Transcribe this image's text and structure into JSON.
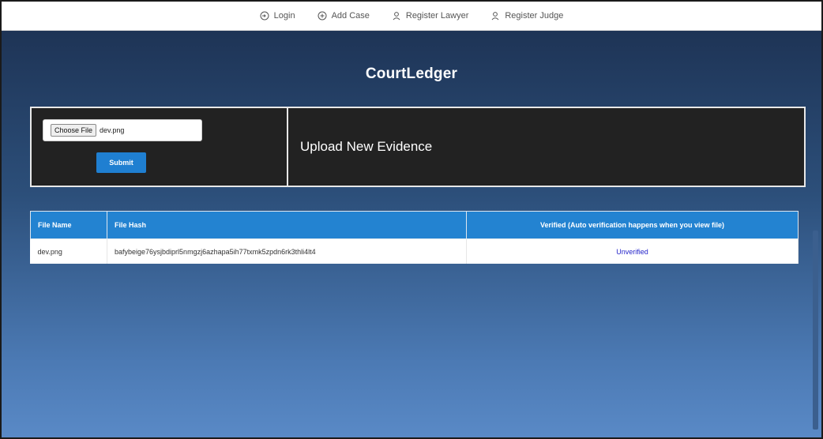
{
  "nav": {
    "items": [
      {
        "label": "Login",
        "icon": "login-icon"
      },
      {
        "label": "Add Case",
        "icon": "plus-circle-icon"
      },
      {
        "label": "Register Lawyer",
        "icon": "user-icon"
      },
      {
        "label": "Register Judge",
        "icon": "user-icon"
      }
    ]
  },
  "brand": "CourtLedger",
  "upload": {
    "choose_label": "Choose File",
    "file_name": "dev.png",
    "submit_label": "Submit",
    "title": "Upload New Evidence"
  },
  "table": {
    "headers": [
      "File Name",
      "File Hash",
      "Verified (Auto verification happens when you view file)"
    ],
    "rows": [
      {
        "file_name": "dev.png",
        "hash": "bafybeige76ysjbdiprl5nmgzj6azhapa5ih77txmk5zpdn6rk3thli4lt4",
        "status": "Unverified"
      }
    ]
  },
  "colors": {
    "header_blue": "#2383d1",
    "panel_dark": "#222222",
    "status_link": "#2323c9"
  }
}
